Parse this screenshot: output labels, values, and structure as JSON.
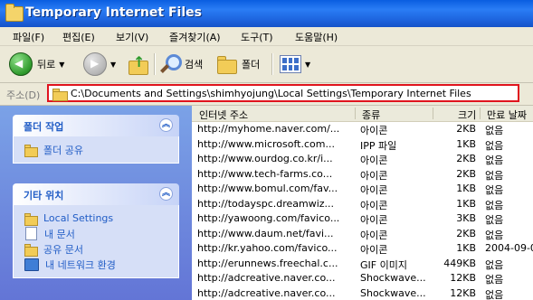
{
  "window": {
    "title": "Temporary Internet Files"
  },
  "menu": [
    {
      "label": "파일(F)"
    },
    {
      "label": "편집(E)"
    },
    {
      "label": "보기(V)"
    },
    {
      "label": "즐겨찾기(A)"
    },
    {
      "label": "도구(T)"
    },
    {
      "label": "도움말(H)"
    }
  ],
  "toolbar": {
    "back_label": "뒤로",
    "search_label": "검색",
    "folders_label": "폴더"
  },
  "address": {
    "label": "주소(D)",
    "value": "C:\\Documents and Settings\\shimhyojung\\Local Settings\\Temporary Internet Files"
  },
  "taskpane": {
    "folder_tasks": {
      "title": "폴더 작업",
      "items": [
        {
          "label": "폴더 공유"
        }
      ]
    },
    "other_places": {
      "title": "기타 위치",
      "items": [
        {
          "label": "Local Settings",
          "icon": "folder-icon"
        },
        {
          "label": "내 문서",
          "icon": "documents-icon"
        },
        {
          "label": "공유 문서",
          "icon": "folder-icon"
        },
        {
          "label": "내 네트워크 환경",
          "icon": "network-icon"
        }
      ]
    }
  },
  "filelist": {
    "columns": [
      "인터넷 주소",
      "종류",
      "크기",
      "만료 날짜"
    ],
    "rows": [
      {
        "name": "http://myhome.naver.com/...",
        "type": "아이콘",
        "size": "2KB",
        "date": "없음"
      },
      {
        "name": "http://www.microsoft.com...",
        "type": "IPP 파일",
        "size": "1KB",
        "date": "없음"
      },
      {
        "name": "http://www.ourdog.co.kr/i...",
        "type": "아이콘",
        "size": "2KB",
        "date": "없음"
      },
      {
        "name": "http://www.tech-farms.co...",
        "type": "아이콘",
        "size": "2KB",
        "date": "없음"
      },
      {
        "name": "http://www.bomul.com/fav...",
        "type": "아이콘",
        "size": "1KB",
        "date": "없음"
      },
      {
        "name": "http://todayspc.dreamwiz...",
        "type": "아이콘",
        "size": "1KB",
        "date": "없음"
      },
      {
        "name": "http://yawoong.com/favico...",
        "type": "아이콘",
        "size": "3KB",
        "date": "없음"
      },
      {
        "name": "http://www.daum.net/favi...",
        "type": "아이콘",
        "size": "2KB",
        "date": "없음"
      },
      {
        "name": "http://kr.yahoo.com/favico...",
        "type": "아이콘",
        "size": "1KB",
        "date": "2004-09-0"
      },
      {
        "name": "http://erunnews.freechal.c...",
        "type": "GIF 이미지",
        "size": "449KB",
        "date": "없음"
      },
      {
        "name": "http://adcreative.naver.co...",
        "type": "Shockwave...",
        "size": "12KB",
        "date": "없음"
      },
      {
        "name": "http://adcreative.naver.co...",
        "type": "Shockwave...",
        "size": "12KB",
        "date": "없음"
      }
    ]
  },
  "colors": {
    "title_bar": "#1d63dd",
    "address_highlight": "#e0141e",
    "task_link": "#215dc6"
  }
}
